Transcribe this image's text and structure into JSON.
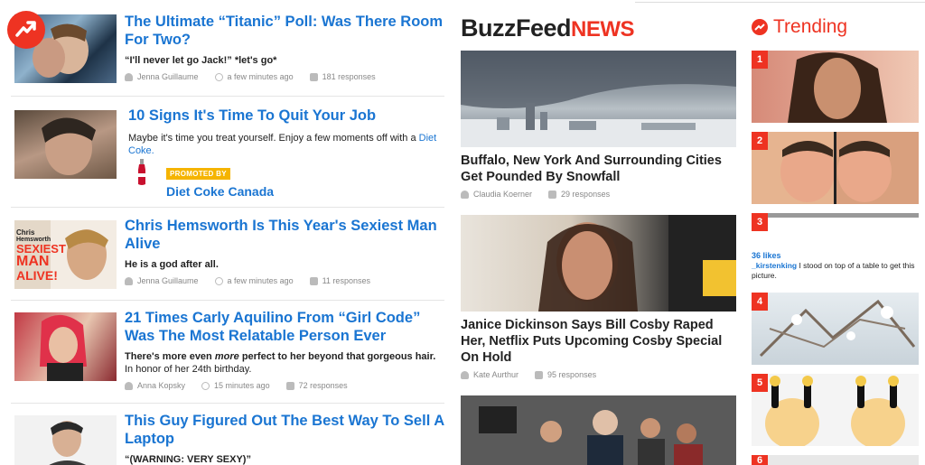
{
  "left": {
    "articles": [
      {
        "title": "The Ultimate “Titanic” Poll: Was There Room For Two?",
        "desc": "“I'll never let go Jack!” *let's go*",
        "author": "Jenna Guillaume",
        "time": "a few minutes ago",
        "responses": "181 responses"
      },
      {
        "title": "10 Signs It's Time To Quit Your Job",
        "desc": "Maybe it's time you treat yourself. Enjoy a few moments off with a",
        "link": "Diet Coke.",
        "promo_tag": "PROMOTED BY",
        "promo_name": "Diet Coke Canada"
      },
      {
        "title": "Chris Hemsworth Is This Year's Sexiest Man Alive",
        "desc": "He is a god after all.",
        "author": "Jenna Guillaume",
        "time": "a few minutes ago",
        "responses": "11 responses"
      },
      {
        "title": "21 Times Carly Aquilino From “Girl Code” Was The Most Relatable Person Ever",
        "desc_a": "There's more even",
        "desc_em": "more",
        "desc_b": "perfect to her beyond that gorgeous hair.",
        "desc_c": "In honor of her 24th birthday.",
        "author": "Anna Kopsky",
        "time": "15 minutes ago",
        "responses": "72 responses"
      },
      {
        "title": "This Guy Figured Out The Best Way To Sell A Laptop",
        "desc": "“(WARNING: VERY SEXY)”"
      }
    ],
    "thumb_text": {
      "chris": "Chris",
      "hemsworth": "Hemsworth",
      "sexiest": "SEXIEST",
      "man": "MAN",
      "alive": "ALIVE!"
    }
  },
  "mid": {
    "logo_bf": "BuzzFeed",
    "logo_news": "NEWS",
    "stories": [
      {
        "title": "Buffalo, New York And Surrounding Cities Get Pounded By Snowfall",
        "author": "Claudia Koerner",
        "responses": "29 responses"
      },
      {
        "title": "Janice Dickinson Says Bill Cosby Raped Her, Netflix Puts Upcoming Cosby Special On Hold",
        "author": "Kate Aurthur",
        "responses": "95 responses"
      }
    ]
  },
  "trending": {
    "heading": "Trending",
    "nums": [
      "1",
      "2",
      "3",
      "4",
      "5",
      "6"
    ],
    "ig_likes": "36 likes",
    "ig_user": "_kirstenking",
    "ig_caption": "I stood on top of a table to get this picture."
  },
  "colors": {
    "brand": "#ee3322",
    "link": "#1a75d2",
    "promo": "#f5b400"
  }
}
